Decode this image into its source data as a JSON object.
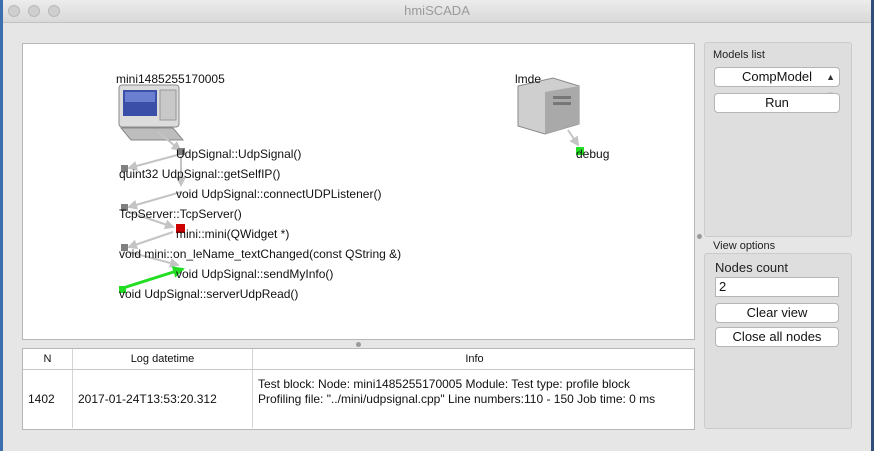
{
  "window": {
    "title": "hmiSCADA"
  },
  "graph": {
    "host_mini": "mini1485255170005",
    "host_lmde": "lmde",
    "debug": "debug",
    "calls": [
      "UdpSignal::UdpSignal()",
      "quint32 UdpSignal::getSelfIP()",
      "void UdpSignal::connectUDPListener()",
      "TcpServer::TcpServer()",
      "mini::mini(QWidget *)",
      "void mini::on_leName_textChanged(const QString &)",
      "void UdpSignal::sendMyInfo()",
      "void UdpSignal::serverUdpRead()"
    ]
  },
  "log": {
    "columns": [
      "N",
      "Log datetime",
      "Info"
    ],
    "rows": [
      {
        "n": "1402",
        "datetime": "2017-01-24T13:53:20.312",
        "info": "Test block:  Node: mini1485255170005  Module:    Test type: profile block  Profiling file: \"../mini/udpsignal.cpp\"  Line numbers:110 - 150  Job time: 0 ms"
      }
    ]
  },
  "models": {
    "title": "Models list",
    "selected": "CompModel",
    "run_label": "Run"
  },
  "view": {
    "title": "View options",
    "nodes_count_label": "Nodes count",
    "nodes_count_value": "2",
    "clear_label": "Clear view",
    "close_all_label": "Close all nodes"
  },
  "colors": {
    "green": "#22dd22",
    "red": "#cc0000",
    "gray_node": "#808080"
  }
}
